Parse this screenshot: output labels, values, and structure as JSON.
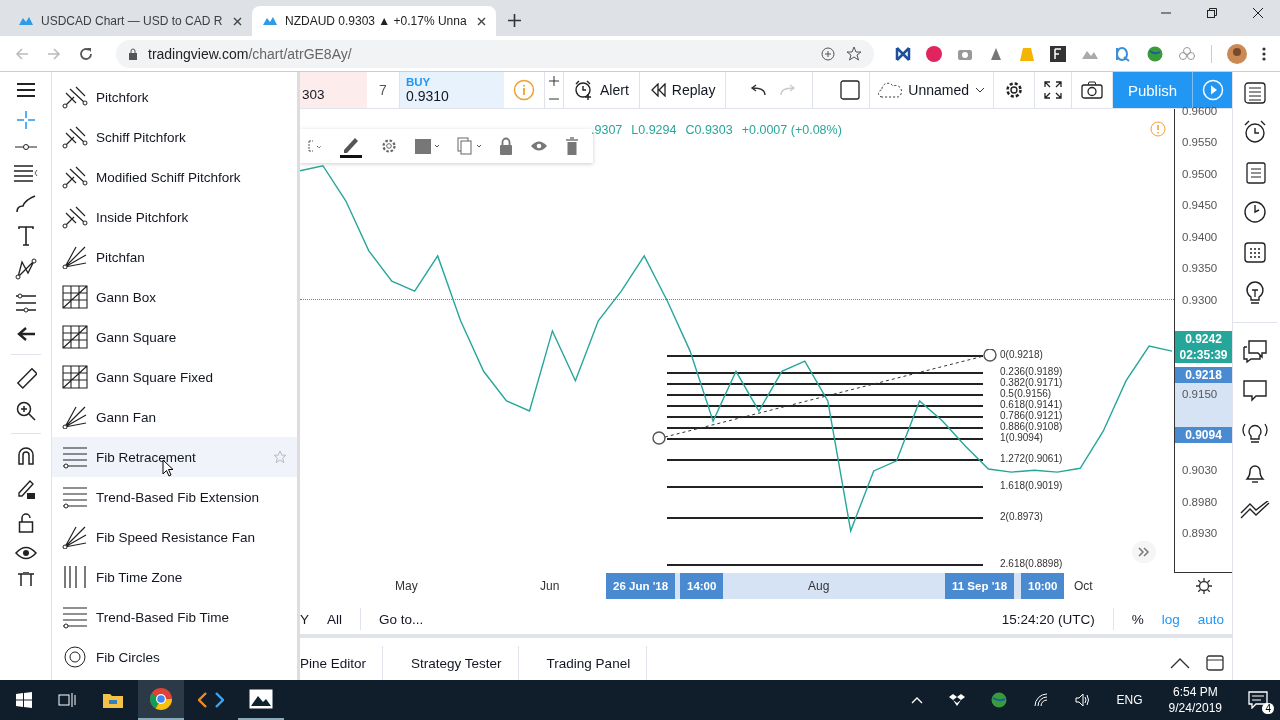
{
  "browser": {
    "tabs": [
      {
        "title": "USDCAD Chart — USD to CAD R",
        "selected": false
      },
      {
        "title": "NZDAUD 0.9303 ▲ +0.17% Unna",
        "selected": true
      }
    ],
    "url_host": "tradingview.com",
    "url_path": "/chart/atrGE8Ay/"
  },
  "toolbar": {
    "sell_price": "303",
    "quantity": "7",
    "buy_label": "BUY",
    "buy_price": "0.9310",
    "alert": "Alert",
    "replay": "Replay",
    "chart_name": "Unnamed",
    "publish": "Publish"
  },
  "drawing_menu": [
    {
      "label": "Pitchfork",
      "kind": "pitchfork",
      "selected": false
    },
    {
      "label": "Schiff Pitchfork",
      "kind": "pitchfork",
      "selected": false
    },
    {
      "label": "Modified Schiff Pitchfork",
      "kind": "pitchfork",
      "selected": false
    },
    {
      "label": "Inside Pitchfork",
      "kind": "pitchfork",
      "selected": false
    },
    {
      "label": "Pitchfan",
      "kind": "fan",
      "selected": false
    },
    {
      "label": "Gann Box",
      "kind": "grid",
      "selected": false
    },
    {
      "label": "Gann Square",
      "kind": "grid",
      "selected": false
    },
    {
      "label": "Gann Square Fixed",
      "kind": "grid",
      "selected": false
    },
    {
      "label": "Gann Fan",
      "kind": "fan",
      "selected": false
    },
    {
      "label": "Fib Retracement",
      "kind": "levels",
      "selected": true
    },
    {
      "label": "Trend-Based Fib Extension",
      "kind": "levels",
      "selected": false
    },
    {
      "label": "Fib Speed Resistance Fan",
      "kind": "fan",
      "selected": false
    },
    {
      "label": "Fib Time Zone",
      "kind": "timezone",
      "selected": false
    },
    {
      "label": "Trend-Based Fib Time",
      "kind": "levels",
      "selected": false
    },
    {
      "label": "Fib Circles",
      "kind": "circles",
      "selected": false
    }
  ],
  "legend": [
    ".9307",
    "L0.9294",
    "C0.9303",
    "+0.0007 (+0.08%)"
  ],
  "fib_levels": [
    "0(0.9218)",
    "0.236(0.9189)",
    "0.382(0.9171)",
    "0.5(0.9156)",
    "0.618(0.9141)",
    "0.786(0.9121)",
    "0.886(0.9108)",
    "1(0.9094)",
    "1.272(0.9061)",
    "1.618(0.9019)",
    "2(0.8973)",
    "2.618(0.8898)"
  ],
  "chart_data": {
    "type": "line",
    "ylim": [
      0.887,
      0.9606
    ],
    "yticks": [
      {
        "value": 0.96,
        "label": "0.9600"
      },
      {
        "value": 0.955,
        "label": "0.9550"
      },
      {
        "value": 0.95,
        "label": "0.9500"
      },
      {
        "value": 0.945,
        "label": "0.9450"
      },
      {
        "value": 0.94,
        "label": "0.9400"
      },
      {
        "value": 0.935,
        "label": "0.9350"
      },
      {
        "value": 0.93,
        "label": "0.9300"
      },
      {
        "value": 0.915,
        "label": "0.9150"
      },
      {
        "value": 0.903,
        "label": "0.9030"
      },
      {
        "value": 0.898,
        "label": "0.8980"
      },
      {
        "value": 0.893,
        "label": "0.8930"
      }
    ],
    "series": [
      {
        "color": "#26a69a",
        "values": [
          0.9508,
          0.9516,
          0.946,
          0.9381,
          0.9333,
          0.9317,
          0.9373,
          0.927,
          0.919,
          0.9143,
          0.9127,
          0.9254,
          0.9175,
          0.927,
          0.9317,
          0.9373,
          0.9302,
          0.9222,
          0.9111,
          0.919,
          0.9127,
          0.919,
          0.9206,
          0.9143,
          0.8937,
          0.9032,
          0.9048,
          0.9143,
          0.9111,
          0.9071,
          0.9035,
          0.903,
          0.9033,
          0.903,
          0.9036,
          0.9095,
          0.9175,
          0.923,
          0.9222
        ]
      }
    ]
  },
  "price_axis": {
    "markers": [
      {
        "text": "0.9242",
        "color": "#26a69a"
      },
      {
        "text": "02:35:39",
        "color": "#26a69a"
      },
      {
        "text": "0.9218",
        "color": "#4a8ad0"
      },
      {
        "text": "0.9094",
        "color": "#4a8ad0"
      }
    ]
  },
  "time_axis": [
    {
      "text": "May",
      "highlighted": false
    },
    {
      "text": "Jun",
      "highlighted": false
    },
    {
      "text": "26 Jun '18",
      "highlighted": true
    },
    {
      "text": "14:00",
      "highlighted": true
    },
    {
      "text": "Aug",
      "highlighted": false
    },
    {
      "text": "11 Sep '18",
      "highlighted": true
    },
    {
      "text": "10:00",
      "highlighted": true
    },
    {
      "text": "Oct",
      "highlighted": false
    }
  ],
  "range_bar": {
    "partial": "Y",
    "all": "All",
    "goto": "Go to...",
    "clock": "15:24:20 (UTC)",
    "percent": "%",
    "log": "log",
    "auto": "auto"
  },
  "panel_tabs": [
    "Pine Editor",
    "Strategy Tester",
    "Trading Panel"
  ],
  "taskbar": {
    "language": "ENG",
    "time": "6:54 PM",
    "date": "9/24/2019",
    "notifications": "4"
  }
}
